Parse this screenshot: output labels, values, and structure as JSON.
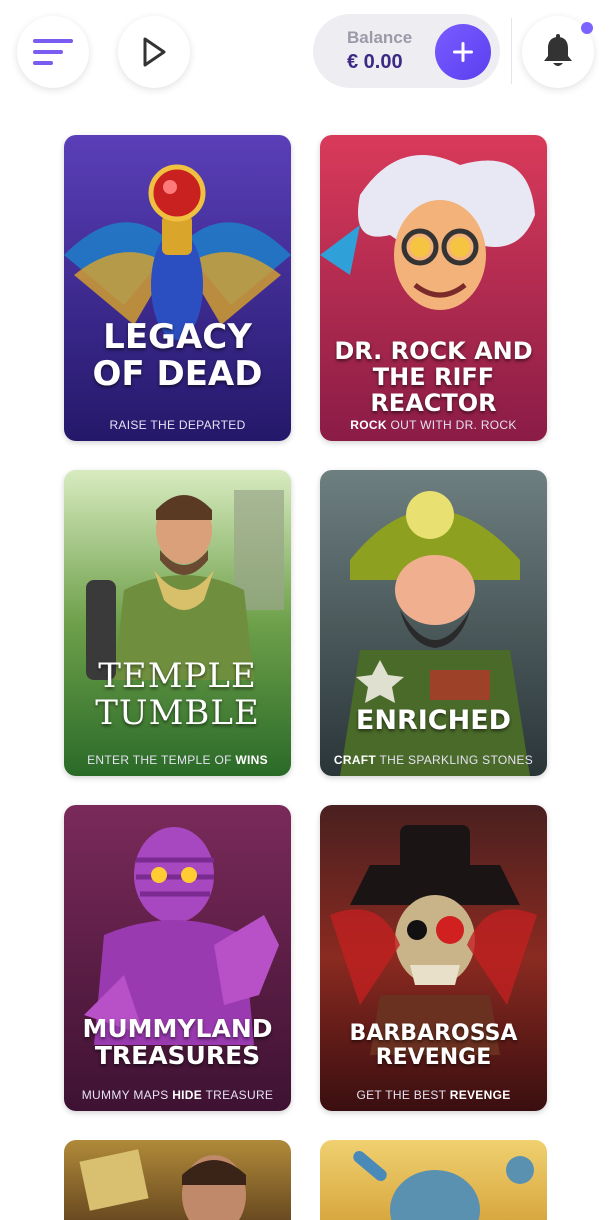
{
  "header": {
    "menu_icon": "hamburger-menu-icon",
    "play_icon": "play-icon",
    "balance_label": "Balance",
    "balance_value": "€ 0.00",
    "deposit_icon": "plus-icon",
    "bell_icon": "bell-icon",
    "accent": "#6b4ff6"
  },
  "games": [
    {
      "title_line1": "LEGACY",
      "title_line2": "OF DEAD",
      "tag_a": "RAISE ",
      "tag_b": "THE DEPARTED",
      "tag_c": "",
      "bg": [
        "#3a2a8f",
        "#2a1e6b"
      ]
    },
    {
      "title_line1": "DR. ROCK AND",
      "title_line2": "THE RIFF REACTOR",
      "tag_a": "ROCK",
      "tag_b": " OUT WITH DR. ROCK",
      "tag_c": "",
      "bg": [
        "#c0334f",
        "#8d1e44"
      ]
    },
    {
      "title_line1": "TEMPLE",
      "title_line2": "TUMBLE",
      "tag_a": "",
      "tag_b": "ENTER THE TEMPLE OF ",
      "tag_c": "WINS",
      "bg": [
        "#5f8d3a",
        "#2f6b2a"
      ]
    },
    {
      "title_line1": "ENRICHED",
      "title_line2": "",
      "tag_a": "CRAFT",
      "tag_b": " THE SPARKLING STONES",
      "tag_c": "",
      "bg": [
        "#4f5e62",
        "#2f3b3f"
      ]
    },
    {
      "title_line1": "MUMMYLAND",
      "title_line2": "TREASURES",
      "tag_a": "",
      "tag_b": "MUMMY MAPS ",
      "tag_c": "HIDE",
      "tag_d": " TREASURE",
      "bg": [
        "#6b2a5c",
        "#4a1840"
      ]
    },
    {
      "title_line1": "BARBAROSSA",
      "title_line2": "REVENGE",
      "tag_a": "",
      "tag_b": "GET THE BEST ",
      "tag_c": "REVENGE",
      "bg": [
        "#5a2424",
        "#3b1010"
      ]
    }
  ]
}
